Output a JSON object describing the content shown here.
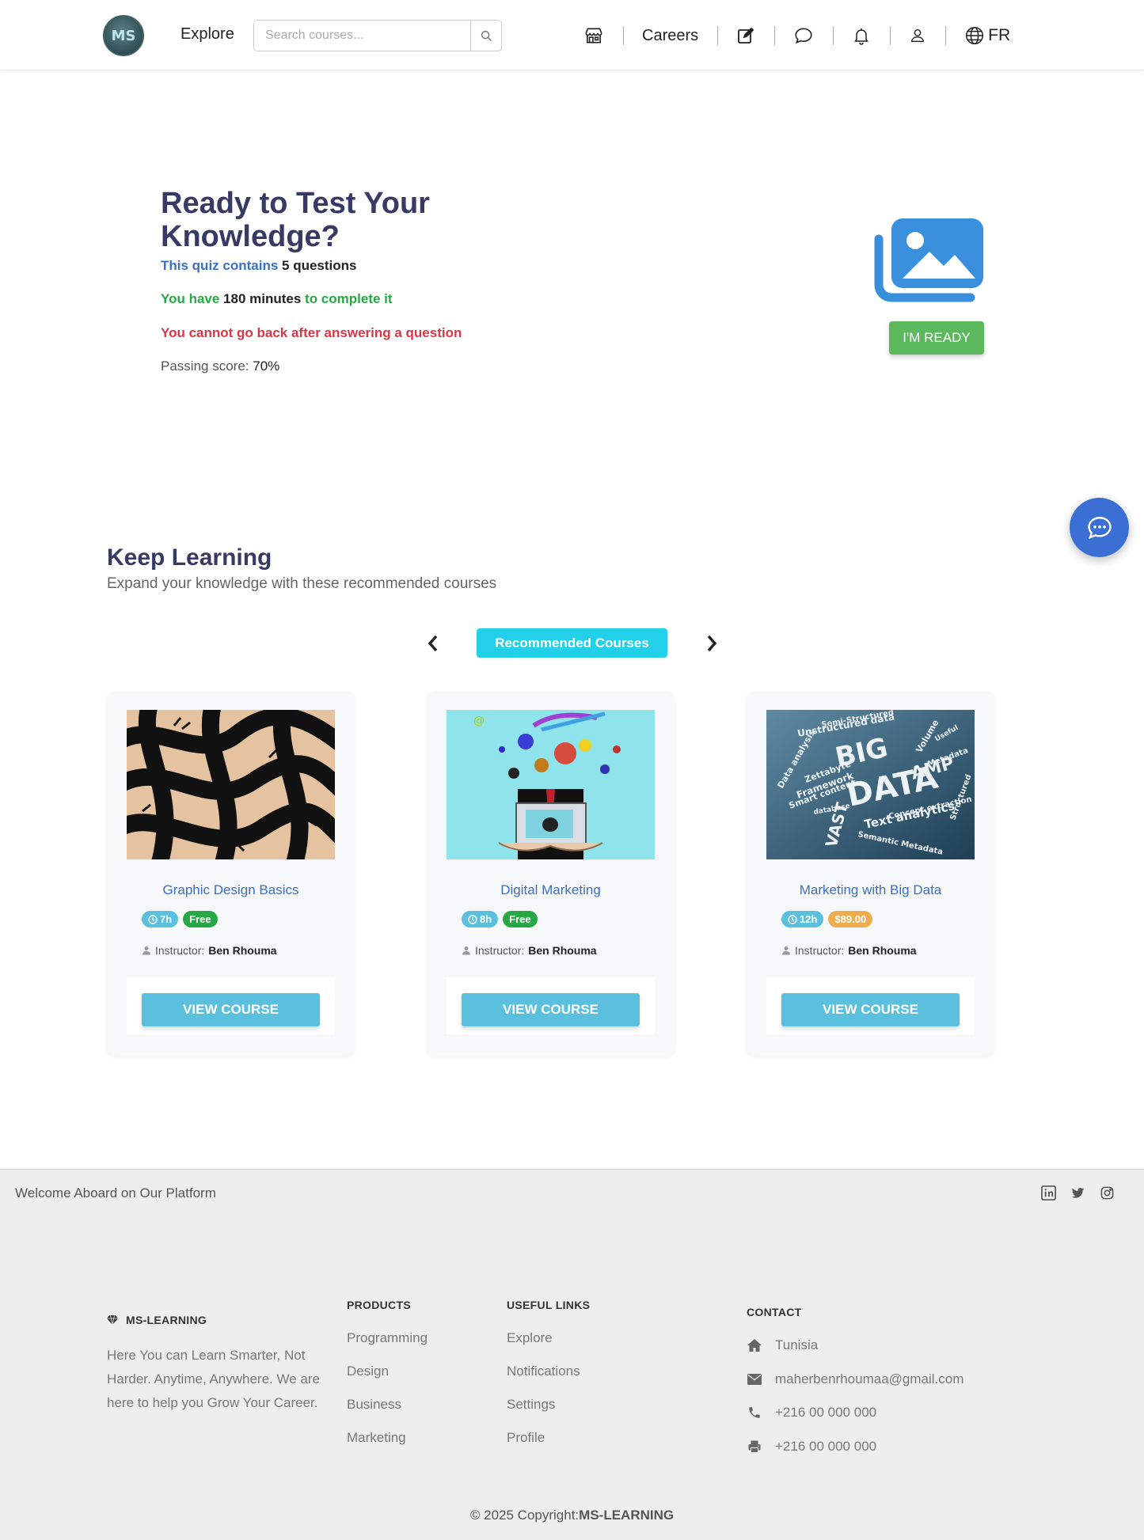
{
  "header": {
    "logo_text": "MS",
    "explore_label": "Explore",
    "search_placeholder": "Search courses...",
    "careers_label": "Careers",
    "language_label": "FR"
  },
  "quiz": {
    "title": "Ready to Test Your Knowledge?",
    "contains_prefix": "This quiz contains ",
    "question_count": "5",
    "contains_suffix": " questions",
    "time_prefix": "You have ",
    "time_value": "180 minutes",
    "time_suffix": " to complete it",
    "warning": "You cannot go back after answering a question",
    "passing_label": "Passing score: ",
    "passing_value": "70%",
    "ready_button": "I'M READY"
  },
  "keep_learning": {
    "title": "Keep Learning",
    "subtitle": "Expand your knowledge with these recommended courses",
    "tab_label": "Recommended Courses",
    "courses": [
      {
        "title": "Graphic Design Basics",
        "duration": "7h",
        "price": "Free",
        "instructor_label": "Instructor:",
        "instructor": "Ben Rhouma",
        "button": "VIEW COURSE"
      },
      {
        "title": "Digital Marketing",
        "duration": "8h",
        "price": "Free",
        "instructor_label": "Instructor:",
        "instructor": "Ben Rhouma",
        "button": "VIEW COURSE"
      },
      {
        "title": "Marketing with Big Data",
        "duration": "12h",
        "price": "$89.00",
        "instructor_label": "Instructor:",
        "instructor": "Ben Rhouma",
        "button": "VIEW COURSE",
        "image_words": [
          "Semi-Structured",
          "Unstructured data",
          "BIG",
          "DATA",
          "AMP",
          "Volume",
          "Metadata",
          "Data analysis",
          "Zettabyte",
          "Framework",
          "Smart content",
          "VAST",
          "Text analytics",
          "Concept extraction",
          "Semantic Metadata",
          "database",
          "Structured",
          "Useful"
        ]
      }
    ]
  },
  "footer": {
    "welcome": "Welcome Aboard on Our Platform",
    "brand": "MS-LEARNING",
    "description": "Here You can Learn Smarter, Not Harder. Anytime, Anywhere. We are here to help you Grow Your Career.",
    "products_title": "PRODUCTS",
    "products": [
      "Programming",
      "Design",
      "Business",
      "Marketing"
    ],
    "links_title": "USEFUL LINKS",
    "links": [
      "Explore",
      "Notifications",
      "Settings",
      "Profile"
    ],
    "contact_title": "CONTACT",
    "contact": {
      "address": "Tunisia",
      "email": "maherbenrhoumaa@gmail.com",
      "phone": "+216 00 000 000",
      "fax": "+216 00 000 000"
    },
    "copyright_prefix": "© 2025 Copyright:",
    "copyright_brand": "MS-LEARNING"
  },
  "colors": {
    "accent_blue": "#3a6fc4",
    "heading": "#363a64",
    "success": "#28a745",
    "danger": "#dc3545",
    "info": "#5bc0de",
    "cyan_tab": "#22d0ea",
    "warning": "#f0ad4e"
  },
  "icons": [
    "store-icon",
    "edit-icon",
    "chat-icon",
    "bell-icon",
    "user-icon",
    "globe-icon",
    "search-icon",
    "image-icon",
    "chevron-left-icon",
    "chevron-right-icon",
    "clock-icon",
    "linkedin-icon",
    "twitter-icon",
    "instagram-icon",
    "diamond-icon",
    "home-icon",
    "envelope-icon",
    "phone-icon",
    "print-icon"
  ]
}
